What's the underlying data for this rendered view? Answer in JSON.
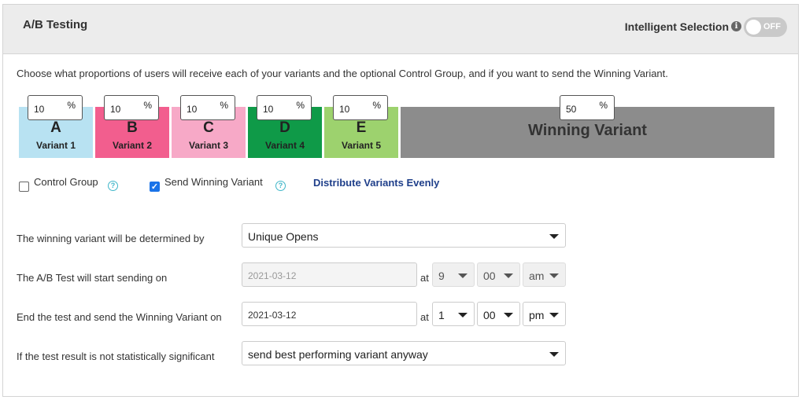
{
  "header": {
    "title": "A/B Testing",
    "intelligent_selection_label": "Intelligent Selection",
    "info_icon": "i",
    "toggle_state": "OFF"
  },
  "description": "Choose what proportions of users will receive each of your variants and the optional Control Group, and if you want to send the Winning Variant.",
  "variants": [
    {
      "letter": "A",
      "name": "Variant 1",
      "percent": "10",
      "color": "#b8e2f2"
    },
    {
      "letter": "B",
      "name": "Variant 2",
      "percent": "10",
      "color": "#f25e8e"
    },
    {
      "letter": "C",
      "name": "Variant 3",
      "percent": "10",
      "color": "#f7a9c7"
    },
    {
      "letter": "D",
      "name": "Variant 4",
      "percent": "10",
      "color": "#0f9a48"
    },
    {
      "letter": "E",
      "name": "Variant 5",
      "percent": "10",
      "color": "#9dd26e"
    }
  ],
  "winner": {
    "label": "Winning Variant",
    "percent": "50",
    "color": "#8c8c8c"
  },
  "percent_symbol": "%",
  "options": {
    "control_group_label": "Control Group",
    "control_group_checked": false,
    "send_winning_label": "Send Winning Variant",
    "send_winning_checked": true,
    "help_icon": "?",
    "distribute_label": "Distribute Variants Evenly"
  },
  "form": {
    "winner_determined_label": "The winning variant will be determined by",
    "winner_determined_value": "Unique Opens",
    "start_label": "The A/B Test will start sending on",
    "start_date": "2021-03-12",
    "start_hour": "9",
    "start_minute": "00",
    "start_ampm": "am",
    "end_label": "End the test and send the Winning Variant on",
    "end_date": "2021-03-12",
    "end_hour": "1",
    "end_minute": "00",
    "end_ampm": "pm",
    "at_label": "at",
    "not_significant_label": "If the test result is not statistically significant",
    "not_significant_value": "send best performing variant anyway"
  }
}
